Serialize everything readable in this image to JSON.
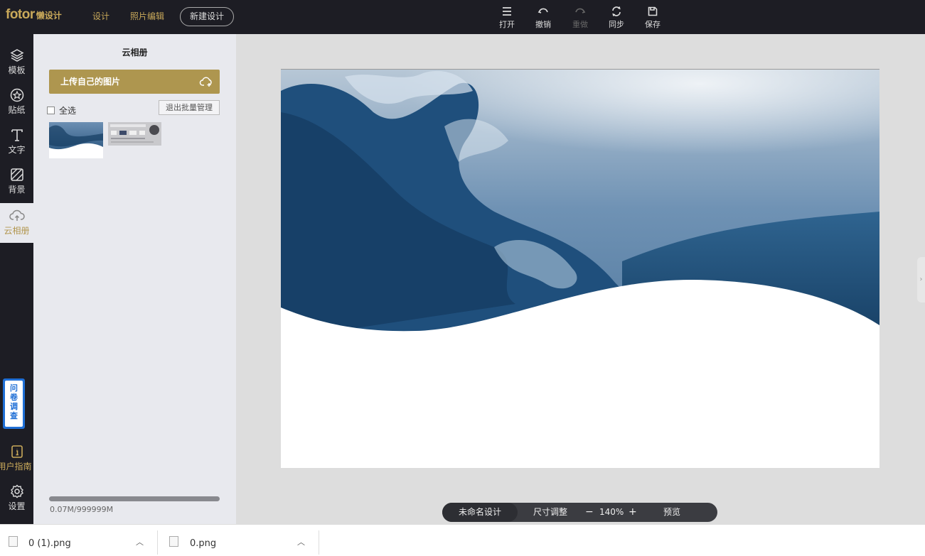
{
  "header": {
    "logo_brand": "fotor",
    "logo_sub": "懒设计",
    "nav": [
      "设计",
      "照片编辑"
    ],
    "new_design": "新建设计",
    "tools": [
      {
        "label": "打开",
        "icon": "menu-icon",
        "enabled": true
      },
      {
        "label": "撤销",
        "icon": "undo-icon",
        "enabled": true
      },
      {
        "label": "重做",
        "icon": "redo-icon",
        "enabled": false
      },
      {
        "label": "同步",
        "icon": "sync-icon",
        "enabled": true
      },
      {
        "label": "保存",
        "icon": "save-icon",
        "enabled": true
      }
    ]
  },
  "sidebar": {
    "items": [
      {
        "label": "模板",
        "icon": "layers-icon"
      },
      {
        "label": "贴纸",
        "icon": "sticker-star-icon"
      },
      {
        "label": "文字",
        "icon": "text-icon"
      },
      {
        "label": "背景",
        "icon": "background-hatch-icon"
      },
      {
        "label": "云相册",
        "icon": "cloud-upload-icon",
        "active": true
      }
    ],
    "survey": "问卷调查",
    "bottom_items": [
      {
        "label": "用户指南",
        "icon": "info-icon"
      },
      {
        "label": "设置",
        "icon": "gear-icon"
      }
    ]
  },
  "panel": {
    "title": "云相册",
    "upload_button": "上传自己的图片",
    "select_all": "全选",
    "exit_batch": "退出批量管理",
    "storage_text": "0.07M/999999M",
    "storage_used_fraction": 0.99
  },
  "bottom_bar": {
    "design_name": "未命名设计",
    "resize": "尺寸调整",
    "zoom_out": "−",
    "zoom": "140%",
    "zoom_in": "+",
    "preview": "预览"
  },
  "downloads": [
    {
      "file": "0 (1).png"
    },
    {
      "file": "0.png"
    }
  ],
  "colors": {
    "accent": "#ae964f",
    "dark": "#1d1d24",
    "panel_bg": "#e8e9ee",
    "workspace_bg": "#dddddd"
  }
}
